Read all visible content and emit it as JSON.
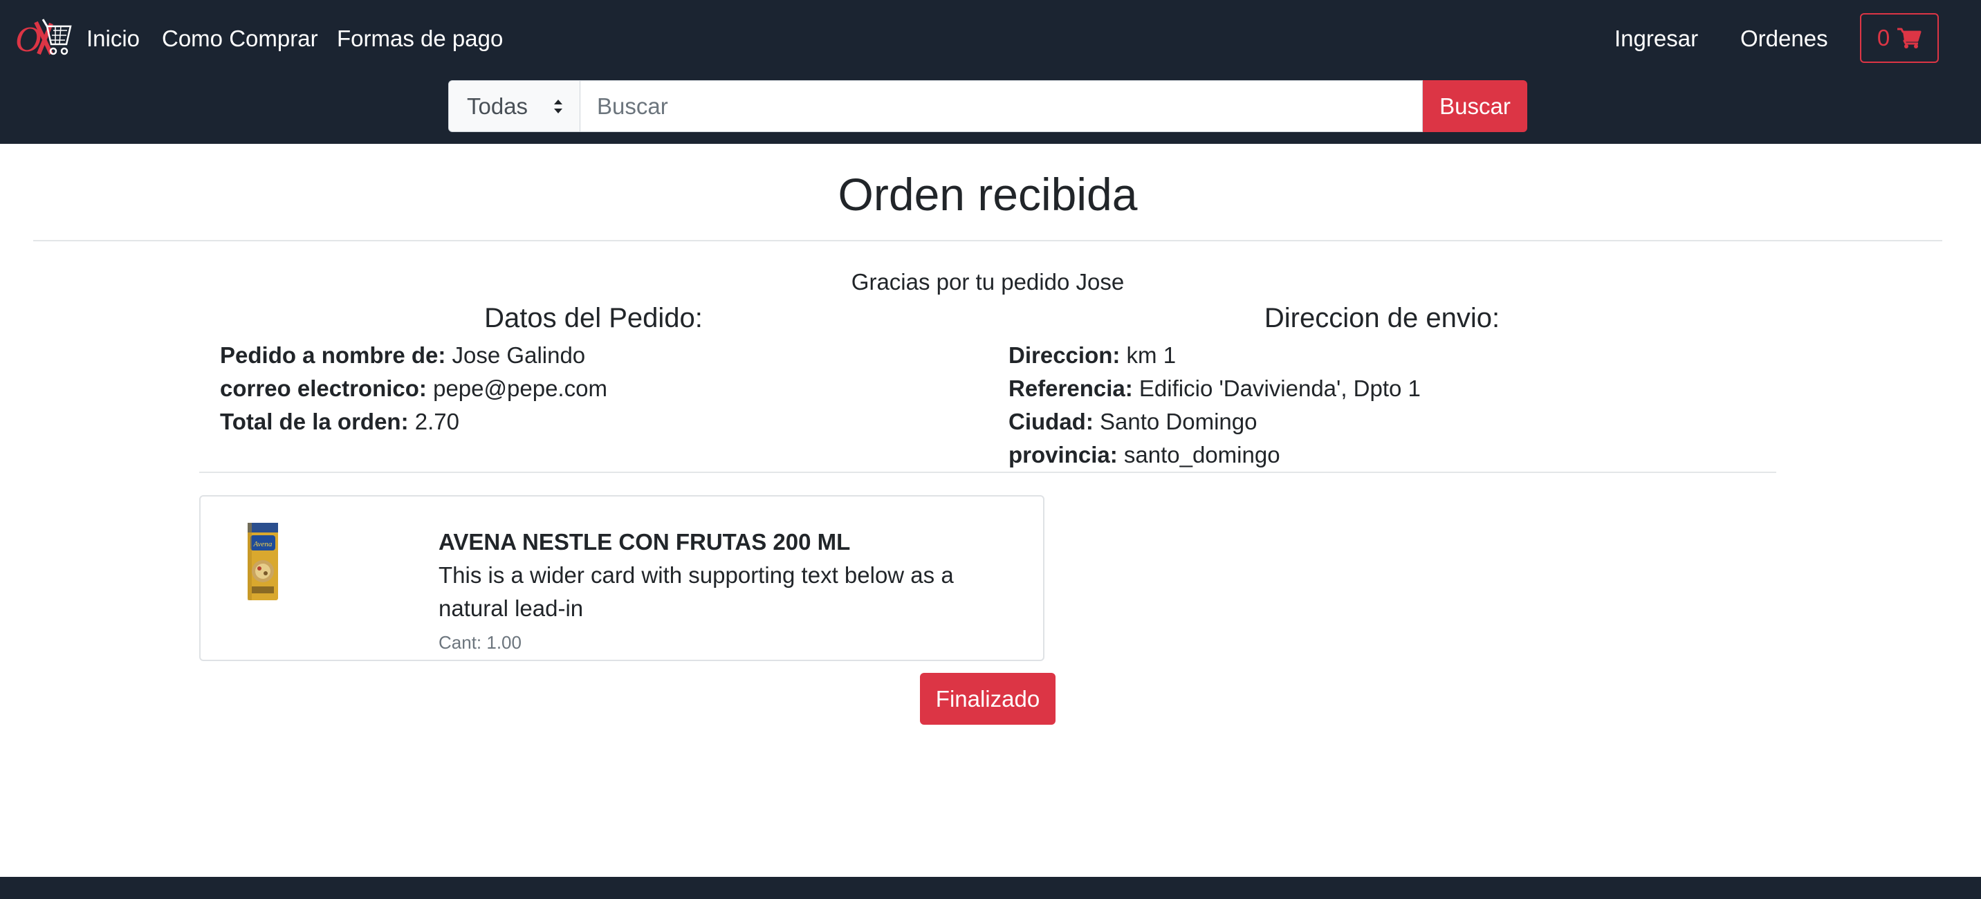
{
  "brand": {
    "logo_text": "OX"
  },
  "nav": {
    "items": [
      {
        "label": "Inicio"
      },
      {
        "label": "Como Comprar"
      },
      {
        "label": "Formas de pago"
      }
    ],
    "login_label": "Ingresar",
    "orders_label": "Ordenes",
    "cart_count": "0"
  },
  "search": {
    "category_selected": "Todas",
    "placeholder": "Buscar",
    "value": "",
    "button_label": "Buscar"
  },
  "order": {
    "title": "Orden recibida",
    "thanks": "Gracias por tu pedido Jose",
    "details_heading": "Datos del Pedido:",
    "details": [
      {
        "label": "Pedido a nombre de:",
        "value": "Jose Galindo"
      },
      {
        "label": "correo electronico:",
        "value": "pepe@pepe.com"
      },
      {
        "label": "Total de la orden:",
        "value": "2.70"
      }
    ],
    "shipping_heading": "Direccion de envio:",
    "shipping": [
      {
        "label": "Direccion:",
        "value": "km 1"
      },
      {
        "label": "Referencia:",
        "value": "Edificio 'Davivienda', Dpto 1"
      },
      {
        "label": "Ciudad:",
        "value": "Santo Domingo"
      },
      {
        "label": "provincia:",
        "value": "santo_domingo"
      }
    ],
    "items": [
      {
        "name": "AVENA NESTLE CON FRUTAS 200 ML",
        "description": "This is a wider card with supporting text below as a natural lead-in",
        "quantity": "Cant: 1.00"
      }
    ],
    "status_label": "Finalizado"
  },
  "colors": {
    "navbar": "#1b2431",
    "accent": "#dc3545",
    "text": "#212529",
    "muted": "#6c757d"
  }
}
